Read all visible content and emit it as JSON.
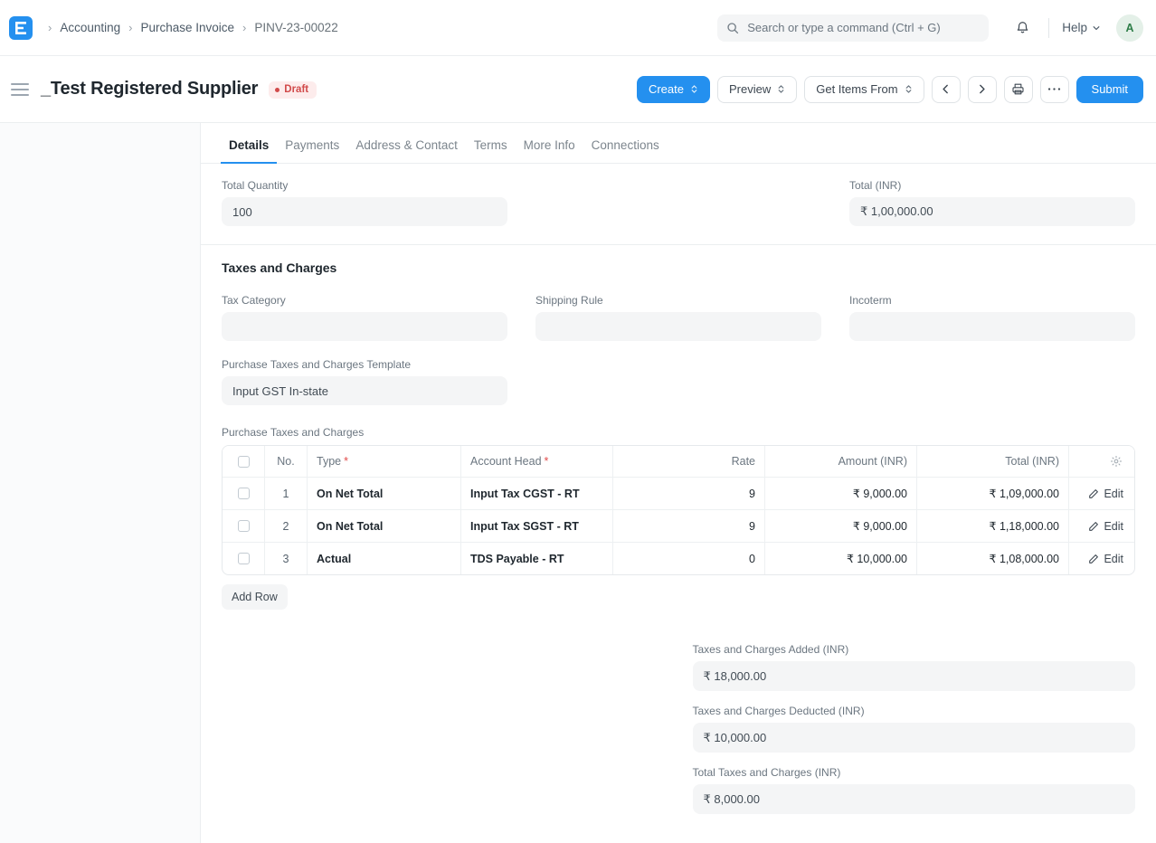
{
  "navbar": {
    "logo_icon": "erpnext-logo-icon",
    "breadcrumb": [
      {
        "label": "Accounting"
      },
      {
        "label": "Purchase Invoice"
      },
      {
        "label": "PINV-23-00022"
      }
    ],
    "search": {
      "placeholder": "Search or type a command (Ctrl + G)",
      "icon": "search-icon",
      "value": ""
    },
    "notifications_icon": "bell-icon",
    "help_label": "Help",
    "help_caret_icon": "chevron-down-icon",
    "avatar_initial": "A"
  },
  "pagehead": {
    "menu_icon": "hamburger-icon",
    "title": "_Test Registered Supplier",
    "status": "Draft",
    "actions": {
      "create": "Create",
      "preview": "Preview",
      "get_items_from": "Get Items From",
      "prev_icon": "chevron-left-icon",
      "next_icon": "chevron-right-icon",
      "print_icon": "printer-icon",
      "more_icon": "ellipsis-icon",
      "submit": "Submit"
    }
  },
  "tabs": [
    {
      "label": "Details",
      "active": true
    },
    {
      "label": "Payments",
      "active": false
    },
    {
      "label": "Address & Contact",
      "active": false
    },
    {
      "label": "Terms",
      "active": false
    },
    {
      "label": "More Info",
      "active": false
    },
    {
      "label": "Connections",
      "active": false
    }
  ],
  "totals_top": {
    "total_quantity_label": "Total Quantity",
    "total_quantity_value": "100",
    "total_inr_label": "Total (INR)",
    "total_inr_value": "₹ 1,00,000.00"
  },
  "taxes_section": {
    "title": "Taxes and Charges",
    "tax_category_label": "Tax Category",
    "tax_category_value": "",
    "shipping_rule_label": "Shipping Rule",
    "shipping_rule_value": "",
    "incoterm_label": "Incoterm",
    "incoterm_value": "",
    "template_label": "Purchase Taxes and Charges Template",
    "template_value": "Input GST In-state"
  },
  "taxes_grid": {
    "label": "Purchase Taxes and Charges",
    "columns": {
      "no": "No.",
      "type": "Type",
      "account_head": "Account Head",
      "rate": "Rate",
      "amount": "Amount (INR)",
      "total": "Total (INR)",
      "settings_icon": "gear-icon"
    },
    "rows": [
      {
        "no": "1",
        "type": "On Net Total",
        "account_head": "Input Tax CGST - RT",
        "rate": "9",
        "amount": "₹ 9,000.00",
        "total": "₹ 1,09,000.00",
        "edit": "Edit"
      },
      {
        "no": "2",
        "type": "On Net Total",
        "account_head": "Input Tax SGST - RT",
        "rate": "9",
        "amount": "₹ 9,000.00",
        "total": "₹ 1,18,000.00",
        "edit": "Edit"
      },
      {
        "no": "3",
        "type": "Actual",
        "account_head": "TDS Payable - RT",
        "rate": "0",
        "amount": "₹ 10,000.00",
        "total": "₹ 1,08,000.00",
        "edit": "Edit"
      }
    ],
    "add_row_label": "Add Row"
  },
  "charges_totals": {
    "added_label": "Taxes and Charges Added (INR)",
    "added_value": "₹ 18,000.00",
    "deducted_label": "Taxes and Charges Deducted (INR)",
    "deducted_value": "₹ 10,000.00",
    "total_label": "Total Taxes and Charges (INR)",
    "total_value": "₹ 8,000.00"
  },
  "colors": {
    "accent": "#2490EF",
    "draft_red": "#d14a4a",
    "draft_bg": "#fdecec",
    "avatar_bg": "#e4f0e8",
    "avatar_fg": "#2e7d48",
    "field_bg": "#f4f5f6",
    "required_star": "#e24c4b"
  }
}
